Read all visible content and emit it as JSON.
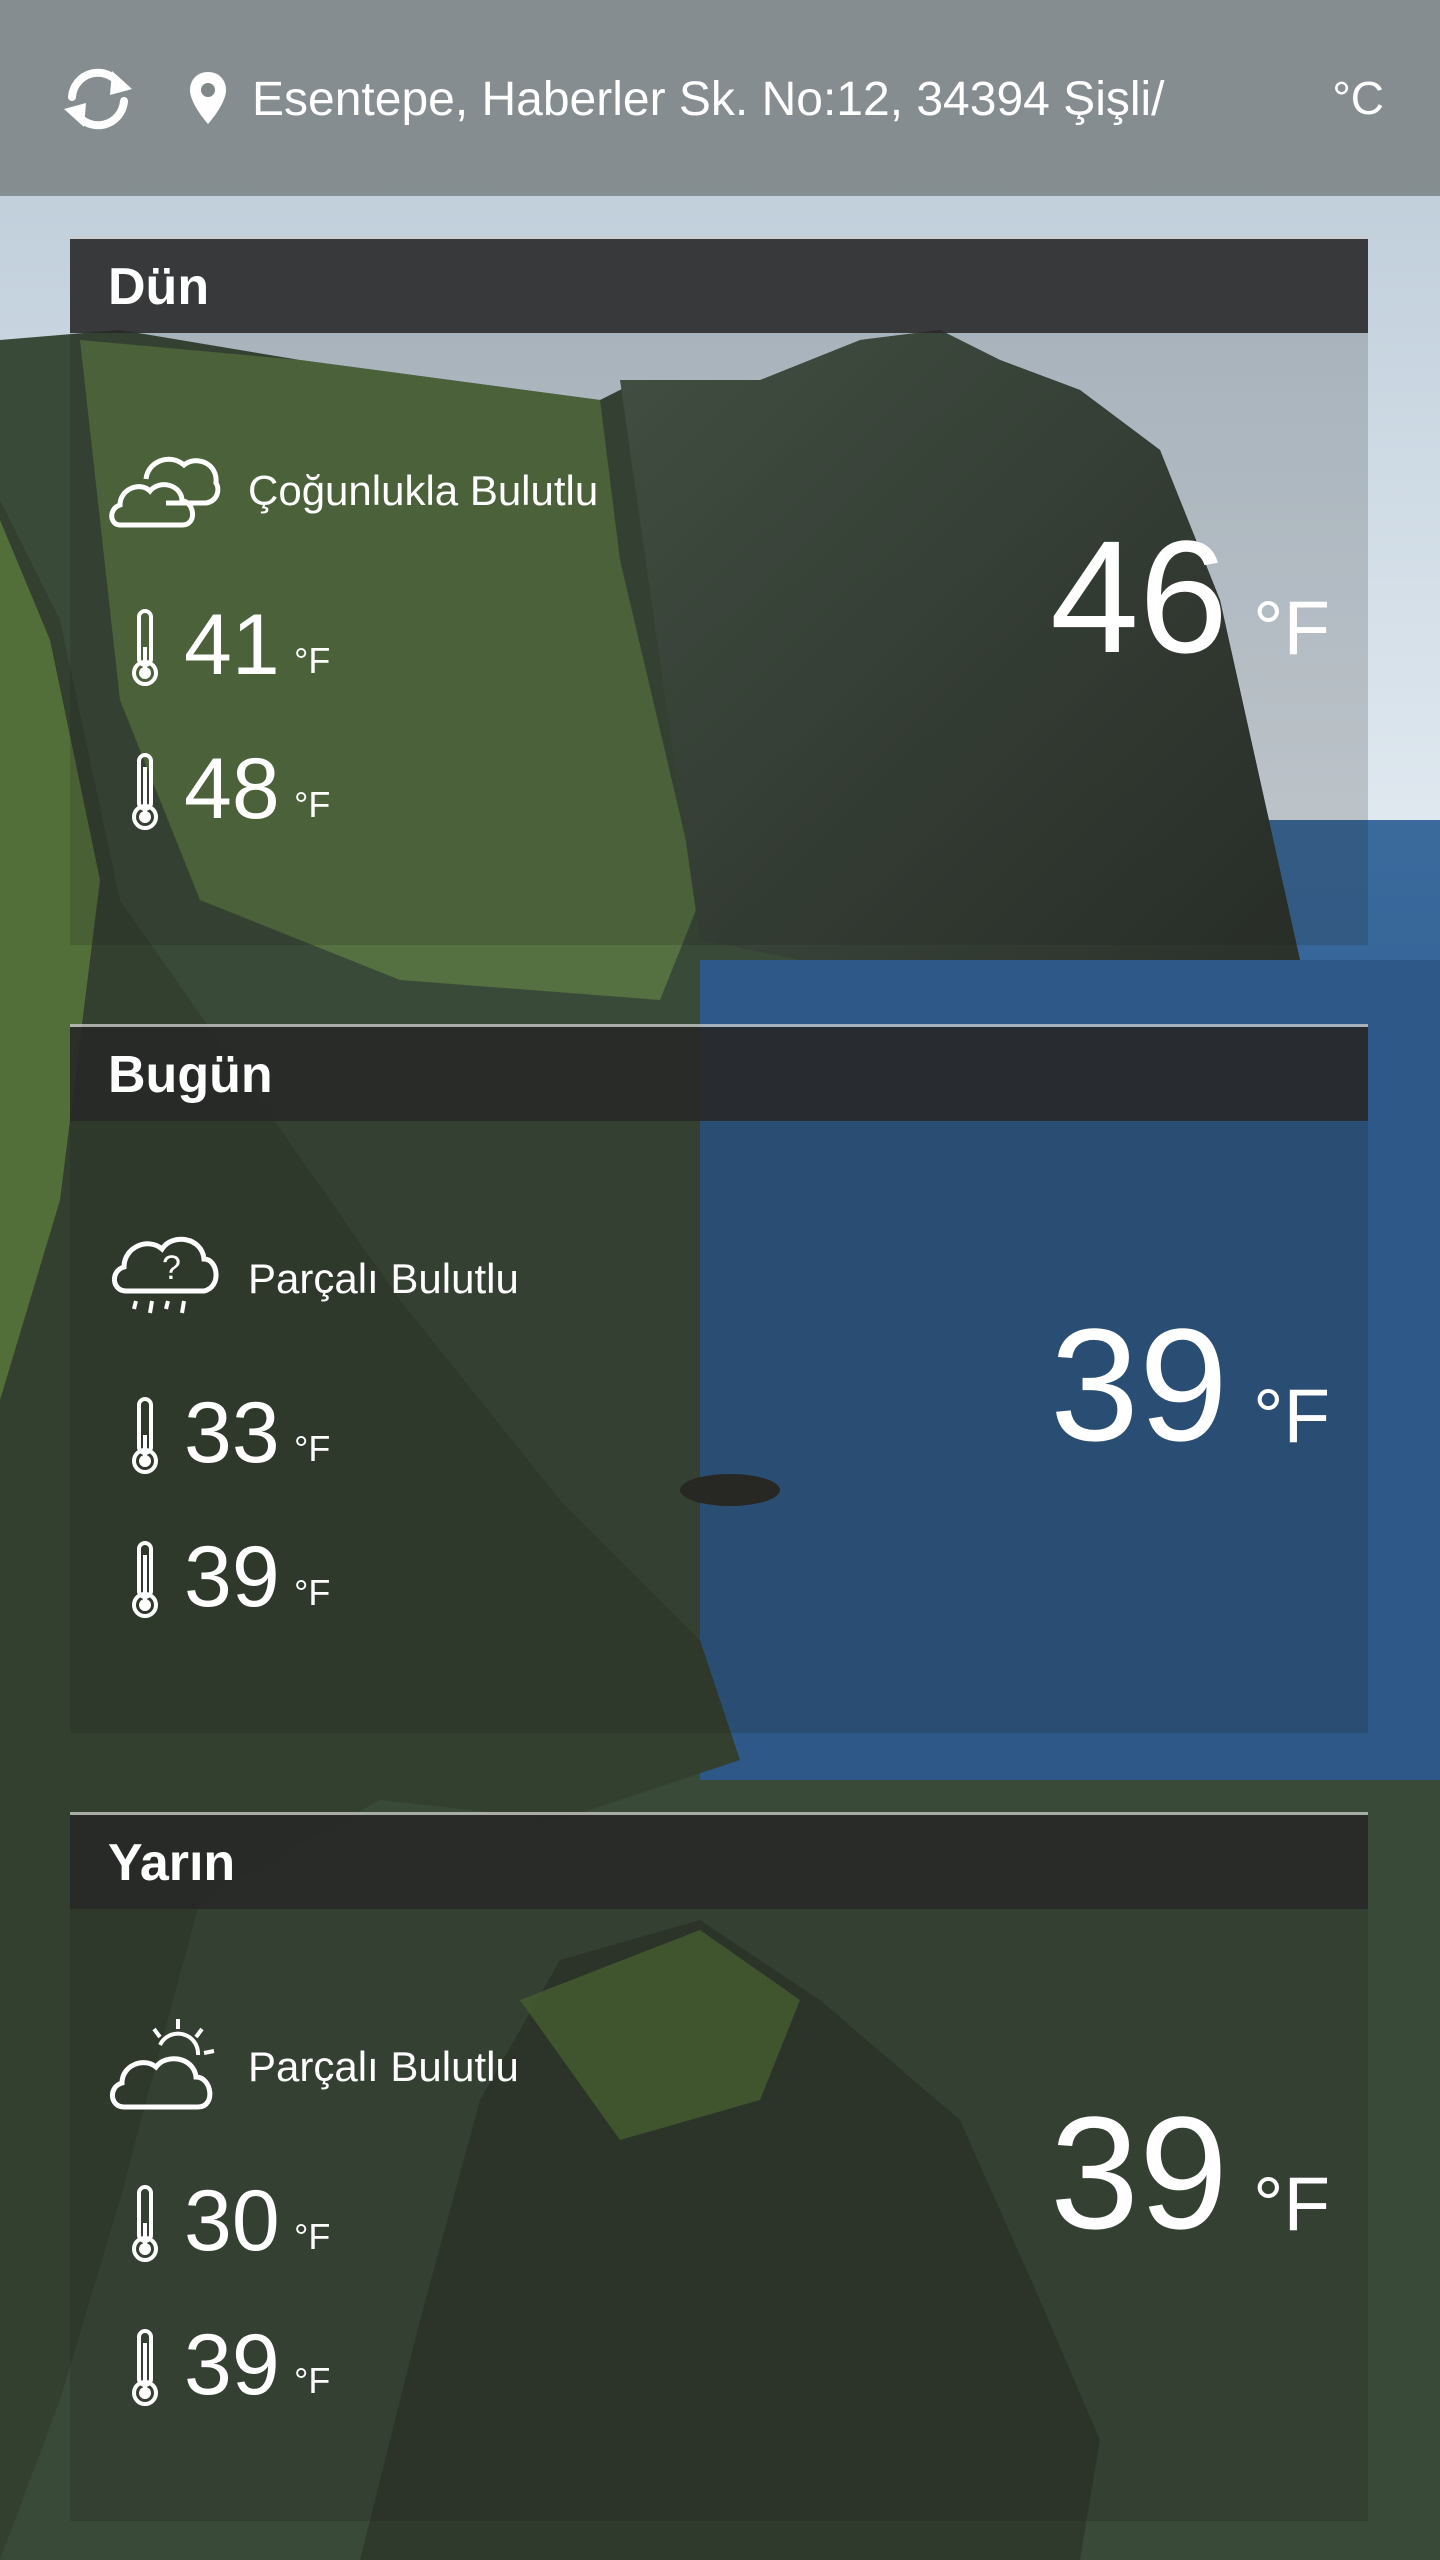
{
  "topbar": {
    "refresh_icon": "refresh-icon",
    "location_icon": "map-pin-icon",
    "address": "Esentepe, Haberler Sk. No:12, 34394 Şişli/",
    "unit_toggle": "°C"
  },
  "days": [
    {
      "title": "Dün",
      "condition_icon": "mostly-cloudy-icon",
      "condition": "Çoğunlukla Bulutlu",
      "low": "41",
      "high": "48",
      "current": "46",
      "unit": "°F"
    },
    {
      "title": "Bugün",
      "condition_icon": "cloud-rain-question-icon",
      "condition": "Parçalı Bulutlu",
      "low": "33",
      "high": "39",
      "current": "39",
      "unit": "°F"
    },
    {
      "title": "Yarın",
      "condition_icon": "partly-cloudy-sun-icon",
      "condition": "Parçalı Bulutlu",
      "low": "30",
      "high": "39",
      "current": "39",
      "unit": "°F"
    }
  ],
  "colors": {
    "topbar_bg": "#80888a",
    "card_header_bg": "#282828",
    "text": "#ffffff"
  }
}
